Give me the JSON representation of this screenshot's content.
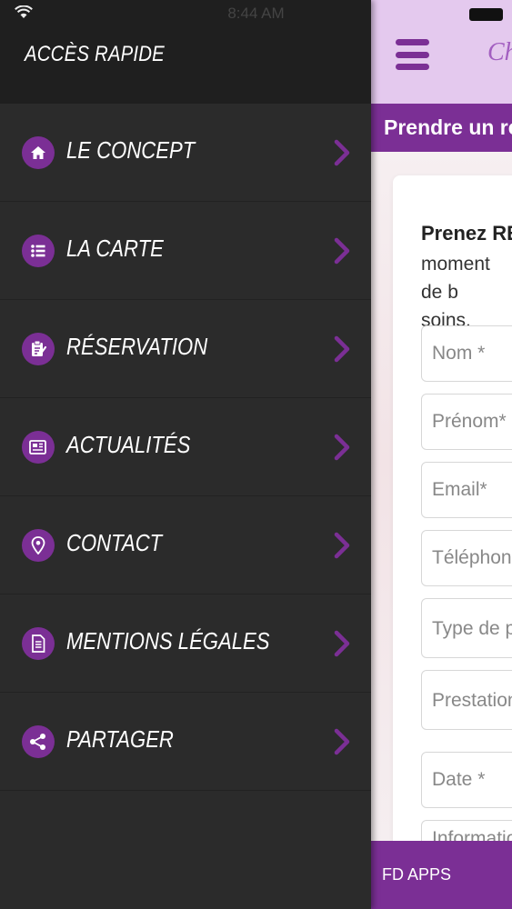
{
  "status_bar": {
    "time": "8:44 AM",
    "wifi_icon": "wifi-icon",
    "battery_icon": "battery-icon"
  },
  "drawer": {
    "title": "ACCÈS RAPIDE",
    "items": [
      {
        "label": "LE CONCEPT",
        "icon": "home-icon"
      },
      {
        "label": "LA CARTE",
        "icon": "list-icon"
      },
      {
        "label": "RÉSERVATION",
        "icon": "clipboard-icon"
      },
      {
        "label": "ACTUALITÉS",
        "icon": "news-icon"
      },
      {
        "label": "CONTACT",
        "icon": "location-pin-icon"
      },
      {
        "label": "MENTIONS LÉGALES",
        "icon": "document-icon"
      },
      {
        "label": "PARTAGER",
        "icon": "share-icon"
      }
    ]
  },
  "app": {
    "title": "Ch",
    "banner": "Prendre un rend",
    "card": {
      "heading": "Prenez REN",
      "text": "moment de b soins."
    },
    "fields": {
      "nom": "Nom *",
      "prenom": "Prénom*",
      "email": "Email*",
      "telephone": "Téléphone *",
      "type": "Type de pre",
      "prestation": "Prestation s",
      "date": "Date *",
      "info": "Information"
    },
    "footer": "FD APPS"
  },
  "colors": {
    "accent": "#7b2f95",
    "drawer_bg": "#2b2b2b",
    "drawer_header_bg": "#1f1f1f",
    "header_bg": "#e4c9ee"
  }
}
